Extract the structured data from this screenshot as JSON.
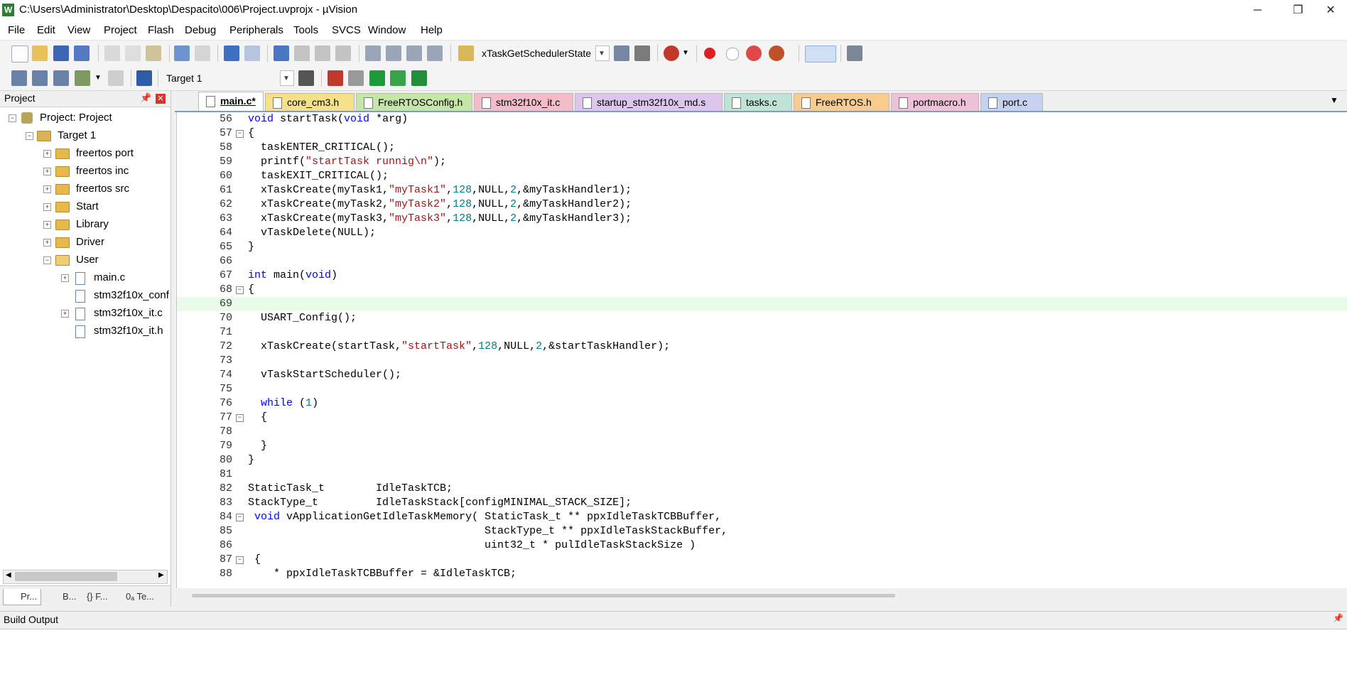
{
  "window": {
    "title": "C:\\Users\\Administrator\\Desktop\\Despacito\\006\\Project.uvprojx - µVision",
    "app_icon": "W",
    "minimize": "─",
    "maximize": "❐",
    "close": "✕"
  },
  "menu": [
    "File",
    "Edit",
    "View",
    "Project",
    "Flash",
    "Debug",
    "Peripherals",
    "Tools",
    "SVCS",
    "Window",
    "Help"
  ],
  "toolbar": {
    "find_combo": "xTaskGetSchedulerState",
    "target_combo": "Target 1"
  },
  "project_panel": {
    "title": "Project",
    "root": "Project: Project",
    "target": "Target 1",
    "groups": [
      "freertos port",
      "freertos inc",
      "freertos src",
      "Start",
      "Library",
      "Driver",
      "User"
    ],
    "user_files": [
      "main.c",
      "stm32f10x_conf",
      "stm32f10x_it.c",
      "stm32f10x_it.h"
    ],
    "bottom_tabs": [
      "Pr...",
      "B...",
      "{} F...",
      "0ₐ Te..."
    ]
  },
  "editor_tabs": [
    {
      "label": "main.c*",
      "color": "#ffffff",
      "active": true
    },
    {
      "label": "core_cm3.h",
      "color": "#f6e08a"
    },
    {
      "label": "FreeRTOSConfig.h",
      "color": "#c6e6a8"
    },
    {
      "label": "stm32f10x_it.c",
      "color": "#f3bcc8"
    },
    {
      "label": "startup_stm32f10x_md.s",
      "color": "#ddc6ec"
    },
    {
      "label": "tasks.c",
      "color": "#bfe3d6"
    },
    {
      "label": "FreeRTOS.h",
      "color": "#f8cc8e"
    },
    {
      "label": "portmacro.h",
      "color": "#efc1d7"
    },
    {
      "label": "port.c",
      "color": "#c7d3ee"
    }
  ],
  "code": [
    {
      "n": "56",
      "t": "void startTask(void *arg)"
    },
    {
      "n": "57",
      "t": "{",
      "box": "−"
    },
    {
      "n": "58",
      "t": "  taskENTER_CRITICAL();"
    },
    {
      "n": "59",
      "t": "  printf(\"startTask runnig\\n\");"
    },
    {
      "n": "60",
      "t": "  taskEXIT_CRITICAL();"
    },
    {
      "n": "61",
      "t": "  xTaskCreate(myTask1,\"myTask1\",128,NULL,2,&myTaskHandler1);"
    },
    {
      "n": "62",
      "t": "  xTaskCreate(myTask2,\"myTask2\",128,NULL,2,&myTaskHandler2);"
    },
    {
      "n": "63",
      "t": "  xTaskCreate(myTask3,\"myTask3\",128,NULL,2,&myTaskHandler3);"
    },
    {
      "n": "64",
      "t": "  vTaskDelete(NULL);"
    },
    {
      "n": "65",
      "t": "}"
    },
    {
      "n": "66",
      "t": ""
    },
    {
      "n": "67",
      "t": "int main(void)"
    },
    {
      "n": "68",
      "t": "{",
      "box": "−"
    },
    {
      "n": "69",
      "t": "",
      "current": true
    },
    {
      "n": "70",
      "t": "  USART_Config();"
    },
    {
      "n": "71",
      "t": ""
    },
    {
      "n": "72",
      "t": "  xTaskCreate(startTask,\"startTask\",128,NULL,2,&startTaskHandler);"
    },
    {
      "n": "73",
      "t": ""
    },
    {
      "n": "74",
      "t": "  vTaskStartScheduler();"
    },
    {
      "n": "75",
      "t": ""
    },
    {
      "n": "76",
      "t": "  while (1)"
    },
    {
      "n": "77",
      "t": "  {",
      "box": "−"
    },
    {
      "n": "78",
      "t": ""
    },
    {
      "n": "79",
      "t": "  }"
    },
    {
      "n": "80",
      "t": "}"
    },
    {
      "n": "81",
      "t": ""
    },
    {
      "n": "82",
      "t": "StaticTask_t        IdleTaskTCB;"
    },
    {
      "n": "83",
      "t": "StackType_t         IdleTaskStack[configMINIMAL_STACK_SIZE];"
    },
    {
      "n": "84",
      "t": " void vApplicationGetIdleTaskMemory( StaticTask_t ** ppxIdleTaskTCBBuffer,",
      "box": "−"
    },
    {
      "n": "85",
      "t": "                                     StackType_t ** ppxIdleTaskStackBuffer,"
    },
    {
      "n": "86",
      "t": "                                     uint32_t * pulIdleTaskStackSize )"
    },
    {
      "n": "87",
      "t": " {",
      "box": "−"
    },
    {
      "n": "88",
      "t": "    * ppxIdleTaskTCBBuffer = &IdleTaskTCB;"
    }
  ],
  "build_output": {
    "title": "Build Output"
  },
  "colors": {
    "keyword": "#0000ff",
    "string": "#a31515",
    "number": "#008080",
    "current_line": "#e8fbe8"
  },
  "icons": [
    "new-file-icon",
    "open-icon",
    "save-icon",
    "save-all-icon",
    "cut-icon",
    "copy-icon",
    "paste-icon",
    "undo-icon",
    "redo-icon",
    "back-icon",
    "forward-icon",
    "bookmark-icon",
    "indent-icon",
    "unindent-icon",
    "comment-icon",
    "uncomment-icon",
    "find-in-files-icon",
    "debug-icon",
    "breakpoint-icon",
    "build-icon",
    "rebuild-icon",
    "download-icon",
    "options-icon",
    "pin-icon",
    "close-icon",
    "folder-icon",
    "file-icon"
  ]
}
